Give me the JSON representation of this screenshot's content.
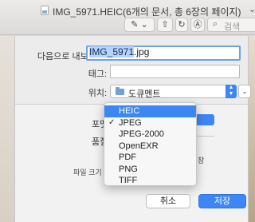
{
  "window": {
    "title": "IMG_5971.HEIC(6개의 문서, 총 6장의 페이지)",
    "chevron": "⌄"
  },
  "toolbar": {
    "markup_glyph": "✎",
    "markup_chevron": "⌄",
    "share_glyph": "⇧",
    "rotate_glyph": "↻",
    "annotate_glyph": "Ⓐ",
    "search_placeholder": "검색",
    "search_icon": "search-icon"
  },
  "dialog": {
    "save_as_label": "다음으로 내보내기:",
    "filename_selected": "IMG_5971",
    "filename_ext": ".jpg",
    "tags_label": "태그:",
    "tags_value": "",
    "location_label": "위치:",
    "location_value": "도큐멘트",
    "stepper_up": "▲",
    "stepper_down": "▼",
    "expand_glyph": "⌄",
    "format_label": "포맷",
    "quality_label": "품질",
    "file_size_label": "파일 크기",
    "right_fragment": "장"
  },
  "format_menu": {
    "items": [
      {
        "label": "HEIC",
        "highlighted": true,
        "checked": false
      },
      {
        "label": "JPEG",
        "highlighted": false,
        "checked": true
      },
      {
        "label": "JPEG-2000",
        "highlighted": false,
        "checked": false
      },
      {
        "label": "OpenEXR",
        "highlighted": false,
        "checked": false
      },
      {
        "label": "PDF",
        "highlighted": false,
        "checked": false
      },
      {
        "label": "PNG",
        "highlighted": false,
        "checked": false
      },
      {
        "label": "TIFF",
        "highlighted": false,
        "checked": false
      }
    ],
    "check_glyph": "✓"
  },
  "buttons": {
    "cancel": "취소",
    "save": "저장"
  },
  "colors": {
    "accent": "#3d86f5",
    "selection": "#b5d3ff"
  }
}
